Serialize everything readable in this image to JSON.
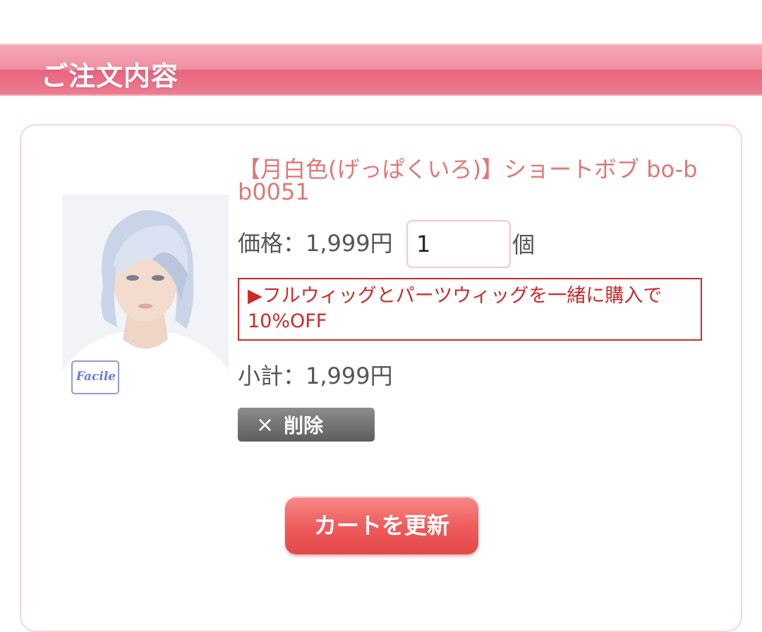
{
  "section": {
    "title": "ご注文内容"
  },
  "item": {
    "name": "【月白色(げっぱくいろ)】ショートボブ bo-bb0051",
    "image_logo_text": "Facile",
    "price_label": "価格：1,999円",
    "quantity": "1",
    "quantity_unit": "個",
    "promo_line1": "▶フルウィッグとパーツウィッグを一緒に購入で",
    "promo_line2": "10%OFF",
    "subtotal_label": "小計：1,999円",
    "delete_icon": "×",
    "delete_label": "削除"
  },
  "actions": {
    "update_cart_label": "カートを更新"
  },
  "colors": {
    "header_pink": "#ec7d92",
    "product_name": "#e07777",
    "promo_red": "#cc2a2a",
    "update_button": "#ee5a5a",
    "delete_button": "#6e6e6e"
  }
}
